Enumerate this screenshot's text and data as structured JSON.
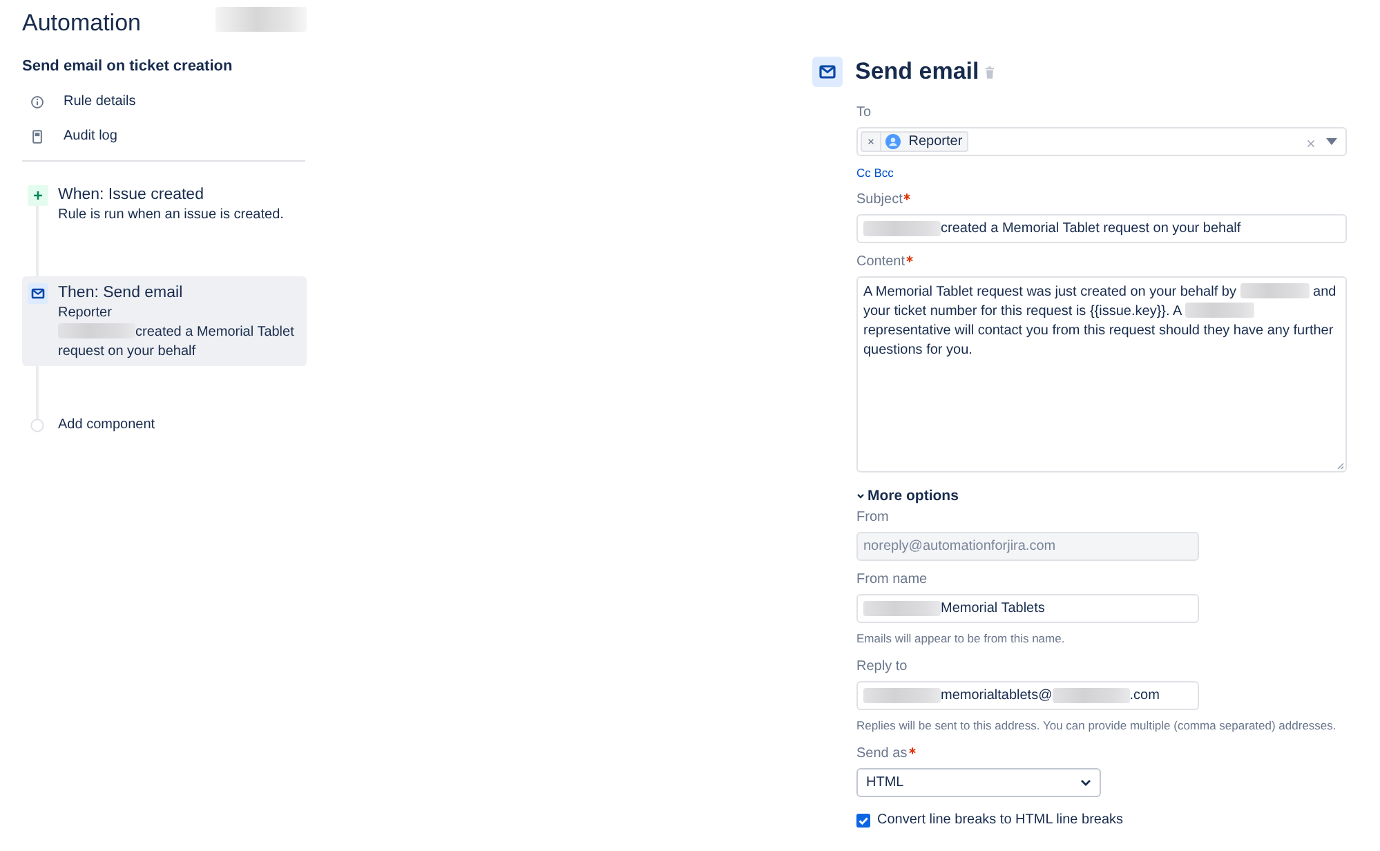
{
  "header": {
    "title": "Automation",
    "redacted": true
  },
  "rule": {
    "name": "Send email on ticket creation",
    "links": [
      {
        "kind": "details",
        "label": "Rule details"
      },
      {
        "kind": "audit",
        "label": "Audit log"
      }
    ]
  },
  "components": [
    {
      "kind": "trigger",
      "title": "When: Issue created",
      "selected": false,
      "lines": [
        [
          {
            "kind": "text",
            "text": "Rule is run when an issue is created."
          }
        ]
      ]
    },
    {
      "kind": "action",
      "title": "Then: Send email",
      "selected": true,
      "lines": [
        [
          {
            "kind": "text",
            "text": "Reporter"
          }
        ],
        [
          {
            "kind": "redacted"
          },
          {
            "kind": "text",
            "text": "created a Memorial Tablet"
          }
        ],
        [
          {
            "kind": "text",
            "text": "request on your behalf"
          }
        ]
      ]
    }
  ],
  "add_component": {
    "label": "Add component"
  },
  "editor": {
    "title": "Send email"
  },
  "fields": [
    {
      "kind": "recipients",
      "label": "To",
      "required": false,
      "chips": [
        "Reporter"
      ]
    },
    {
      "kind": "link",
      "label": "Cc Bcc"
    },
    {
      "kind": "text",
      "label": "Subject",
      "required": true,
      "disabled": false,
      "value": [
        {
          "kind": "redacted"
        },
        {
          "kind": "text",
          "text": "created a Memorial Tablet request on your behalf"
        }
      ]
    },
    {
      "kind": "textarea",
      "label": "Content",
      "required": true,
      "value": [
        {
          "kind": "text",
          "text": "A Memorial Tablet request was just created on your behalf by "
        },
        {
          "kind": "redacted"
        },
        {
          "kind": "text",
          "text": " and your ticket number for this request is {{issue.key}}. A "
        },
        {
          "kind": "redacted"
        },
        {
          "kind": "text",
          "text": " representative will contact you from this request should they have any further questions for you."
        }
      ]
    },
    {
      "kind": "section",
      "label": "More options",
      "expanded": true,
      "fields": [
        {
          "kind": "text",
          "label": "From",
          "required": false,
          "disabled": true,
          "value": [
            {
              "kind": "text",
              "text": "noreply@automationforjira.com"
            }
          ]
        },
        {
          "kind": "text",
          "label": "From name",
          "required": false,
          "disabled": false,
          "value": [
            {
              "kind": "redacted"
            },
            {
              "kind": "text",
              "text": "Memorial Tablets"
            }
          ],
          "help": "Emails will appear to be from this name."
        },
        {
          "kind": "text",
          "label": "Reply to",
          "required": false,
          "disabled": false,
          "value": [
            {
              "kind": "redacted"
            },
            {
              "kind": "text",
              "text": "memorialtablets@"
            },
            {
              "kind": "redacted"
            },
            {
              "kind": "text",
              "text": ".com"
            }
          ],
          "help": "Replies will be sent to this address. You can provide multiple (comma separated) addresses."
        },
        {
          "kind": "select",
          "label": "Send as",
          "required": true,
          "value": "HTML"
        },
        {
          "kind": "checkbox",
          "label": "Convert line breaks to HTML line breaks",
          "checked": true
        }
      ]
    }
  ]
}
